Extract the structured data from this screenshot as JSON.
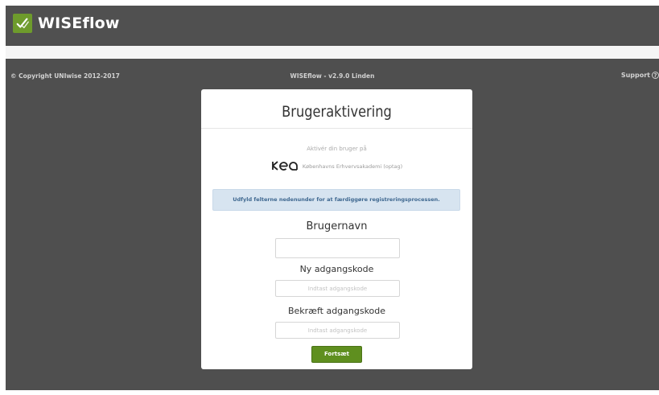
{
  "header": {
    "brand": "WISEflow",
    "brand_icon": "wiseflow-logo-icon"
  },
  "footer": {
    "copyright": "© Copyright UNIwise 2012-2017",
    "version": "WISEflow - v2.9.0 Linden",
    "support_label": "Support",
    "support_icon": "help-circle-icon"
  },
  "card": {
    "title": "Brugeraktivering",
    "activate_text": "Aktivér din bruger på",
    "org_logo": "KEA",
    "org_name": "Københavns Erhvervsakademi (optag)",
    "info_message": "Udfyld felterne nedenunder for at færdiggøre registreringsprocessen.",
    "username_label": "Brugernavn",
    "username_value": "",
    "new_password_label": "Ny adgangskode",
    "new_password_placeholder": "Indtast adgangskode",
    "confirm_password_label": "Bekræft adgangskode",
    "confirm_password_placeholder": "Indtast adgangskode",
    "submit_label": "Fortsæt"
  },
  "colors": {
    "brand_green": "#6e9b2c",
    "button_green": "#5f8f1f",
    "background": "#4f4f4f",
    "info_bg": "#d7e4f0",
    "info_text": "#3f6890"
  }
}
